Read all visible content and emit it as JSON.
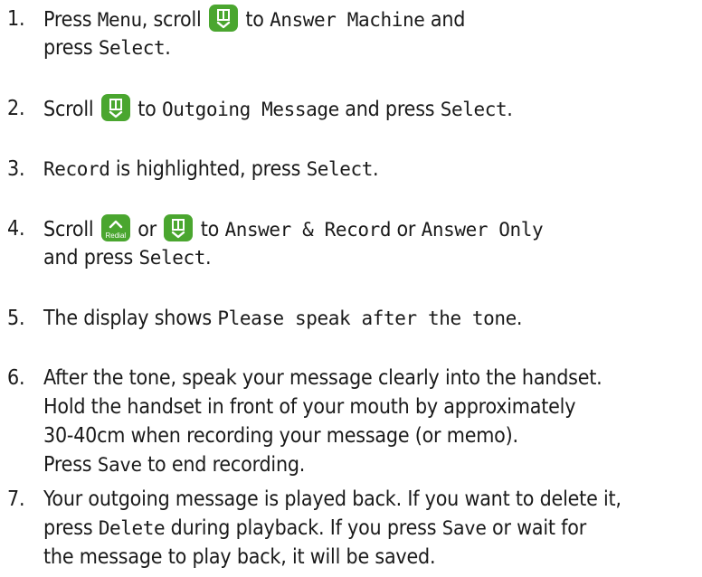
{
  "colors": {
    "key_green": "#4aa62f",
    "text": "#1a1a1a"
  },
  "icons": {
    "down_key": "phonebook-down-key-icon",
    "up_key": "redial-up-key-icon"
  },
  "keys": {
    "redial_label": "Redial"
  },
  "steps": [
    {
      "num": "1.",
      "t1": "Press ",
      "m1": "Menu",
      "t2": ", scroll ",
      "t3": " to ",
      "m2": "Answer Machine",
      "t4": " and",
      "t5": "press ",
      "m3": "Select",
      "t6": "."
    },
    {
      "num": "2.",
      "t1": "Scroll ",
      "t2": " to ",
      "m1": "Outgoing Message",
      "t3": " and press ",
      "m2": "Select",
      "t4": "."
    },
    {
      "num": "3.",
      "m1": "Record",
      "t1": " is highlighted, press ",
      "m2": "Select",
      "t2": "."
    },
    {
      "num": "4.",
      "t1": "Scroll ",
      "t2": " or ",
      "t3": " to ",
      "m1": "Answer & Record",
      "t4": " or ",
      "m2": "Answer Only",
      "t5": "and press ",
      "m3": "Select",
      "t6": "."
    },
    {
      "num": "5.",
      "t1": "The display shows ",
      "m1": "Please speak after the tone",
      "t2": "."
    },
    {
      "num": "6.",
      "l1": "After the tone, speak your message clearly into the handset.",
      "l2": "Hold the handset in front of your mouth by approximately",
      "l3": "30-40cm when recording your message (or memo).",
      "t1": "Press ",
      "m1": "Save",
      "t2": " to end recording."
    },
    {
      "num": "7.",
      "t1": "Your outgoing message is played back. If you want to delete it,",
      "t2": "press ",
      "m1": "Delete",
      "t3": " during playback. If you press ",
      "m2": "Save",
      "t4": " or wait for",
      "t5": "the message to play back, it will be saved."
    }
  ]
}
